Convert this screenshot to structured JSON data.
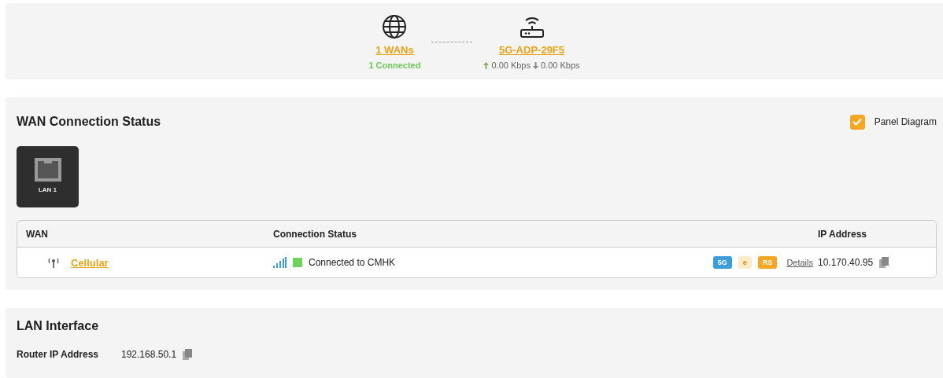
{
  "topology": {
    "wan": {
      "link": "1 WANs",
      "status": "1 Connected"
    },
    "router": {
      "link": "5G-ADP-29F5",
      "upload": "0.00 Kbps",
      "download": "0.00 Kbps"
    }
  },
  "wan_status": {
    "title": "WAN Connection Status",
    "panel_diagram": {
      "label": "Panel Diagram",
      "checked": true
    },
    "ports": [
      {
        "label": "LAN 1"
      }
    ],
    "table": {
      "columns": [
        "WAN",
        "Connection Status",
        "IP Address"
      ],
      "rows": [
        {
          "name": "Cellular",
          "status": "Connected to CMHK",
          "color": "#6dd35a",
          "badges": [
            {
              "label": "5G",
              "color": "#3d9ddb",
              "active": true
            },
            {
              "label": "e",
              "color": "#fcebc7",
              "active": false
            },
            {
              "label": "RS",
              "color": "#f5a623",
              "active": true
            }
          ],
          "details": "Details",
          "ip": "10.170.40.95"
        }
      ]
    }
  },
  "lan": {
    "title": "LAN Interface",
    "router_ip_label": "Router IP Address",
    "router_ip": "192.168.50.1"
  }
}
